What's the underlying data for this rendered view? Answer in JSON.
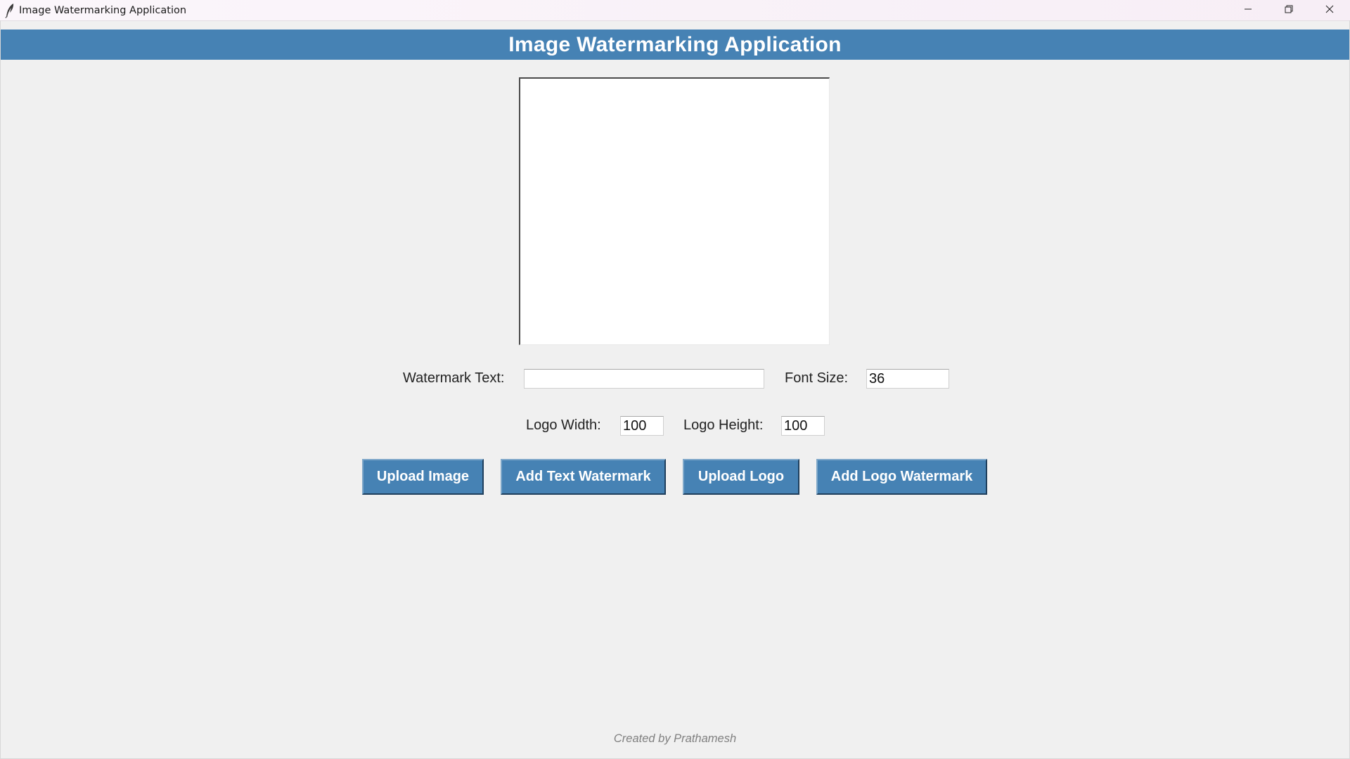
{
  "window": {
    "title": "Image Watermarking Application",
    "icon": "feather-icon",
    "controls": [
      "minimize-icon",
      "restore-icon",
      "close-icon"
    ]
  },
  "header": {
    "title": "Image Watermarking Application",
    "background": "#4682b4"
  },
  "form": {
    "watermark_text_label": "Watermark Text:",
    "watermark_text_value": "",
    "font_size_label": "Font Size:",
    "font_size_value": "36",
    "logo_width_label": "Logo Width:",
    "logo_width_value": "100",
    "logo_height_label": "Logo Height:",
    "logo_height_value": "100"
  },
  "buttons": {
    "upload_image": "Upload Image",
    "add_text_watermark": "Add Text Watermark",
    "upload_logo": "Upload Logo",
    "add_logo_watermark": "Add Logo Watermark"
  },
  "footer": {
    "credit": "Created by Prathamesh"
  },
  "colors": {
    "accent": "#4682b4",
    "background": "#f0f0f0",
    "footer_text": "#808080"
  }
}
